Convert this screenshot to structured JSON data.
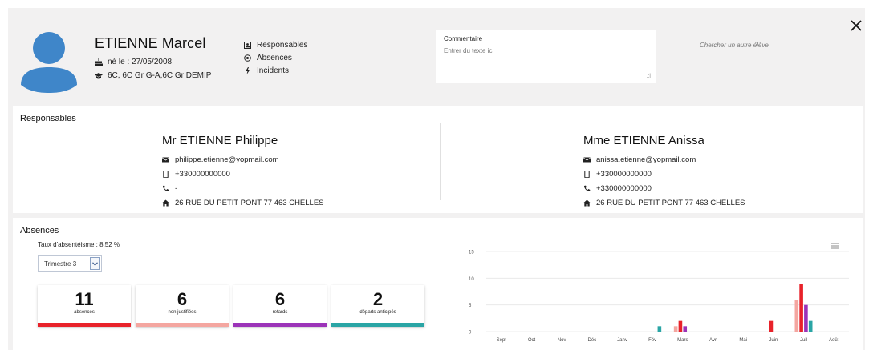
{
  "student": {
    "name": "ETIENNE Marcel",
    "birth": "né le : 27/05/2008",
    "classes": "6C, 6C Gr G-A,6C Gr DEMIP"
  },
  "quick_links": [
    {
      "label": "Responsables",
      "icon": "contact-card-icon"
    },
    {
      "label": "Absences",
      "icon": "clock-circle-icon"
    },
    {
      "label": "Incidents",
      "icon": "bolt-icon"
    }
  ],
  "comment": {
    "label": "Commentaire",
    "placeholder": "Entrer du texte ici"
  },
  "search": {
    "placeholder": "Chercher un autre élève"
  },
  "responsables": {
    "title": "Responsables",
    "parents": [
      {
        "name": "Mr ETIENNE Philippe",
        "email": "philippe.etienne@yopmail.com",
        "mobile": "+330000000000",
        "phone": "-",
        "address": "26 RUE DU PETIT PONT 77 463 CHELLES"
      },
      {
        "name": "Mme ETIENNE Anissa",
        "email": "anissa.etienne@yopmail.com",
        "mobile": "+330000000000",
        "phone": "+330000000000",
        "address": "26 RUE DU PETIT PONT 77 463 CHELLES"
      }
    ]
  },
  "absences": {
    "title": "Absences",
    "rate": "Taux d'absentéisme : 8.52 %",
    "period_selected": "Trimestre 3",
    "stats": [
      {
        "value": "11",
        "label": "absences",
        "color": "#e8222a"
      },
      {
        "value": "6",
        "label": "non justifiées",
        "color": "#f4a6a0"
      },
      {
        "value": "6",
        "label": "retards",
        "color": "#9b33b8"
      },
      {
        "value": "2",
        "label": "départs anticipés",
        "color": "#2aa5a5"
      }
    ]
  },
  "colors": {
    "avatar": "#3f86c9",
    "absences": "#e8222a",
    "non_justifiees": "#f4a6a0",
    "retards": "#9b33b8",
    "departs": "#2aa5a5"
  },
  "chart_data": {
    "type": "bar",
    "categories": [
      "Sept",
      "Oct",
      "Nov",
      "Déc",
      "Janv",
      "Fév",
      "Mars",
      "Avr",
      "Mai",
      "Juin",
      "Juil",
      "Août"
    ],
    "series": [
      {
        "values": [
          0,
          0,
          0,
          0,
          0,
          0,
          1,
          0,
          0,
          0,
          6,
          0
        ],
        "color": "#f4a6a0"
      },
      {
        "values": [
          0,
          0,
          0,
          0,
          0,
          0,
          2,
          0,
          0,
          2,
          9,
          0
        ],
        "color": "#e8222a"
      },
      {
        "values": [
          0,
          0,
          0,
          0,
          0,
          0,
          1,
          0,
          0,
          0,
          5,
          0
        ],
        "color": "#9b33b8"
      },
      {
        "values": [
          0,
          0,
          0,
          0,
          0,
          1,
          0,
          0,
          0,
          0,
          2,
          0
        ],
        "color": "#2aa5a5"
      }
    ],
    "yticks": [
      "0",
      "5",
      "10",
      "15"
    ],
    "ylim": [
      0,
      15
    ],
    "grid": true
  }
}
